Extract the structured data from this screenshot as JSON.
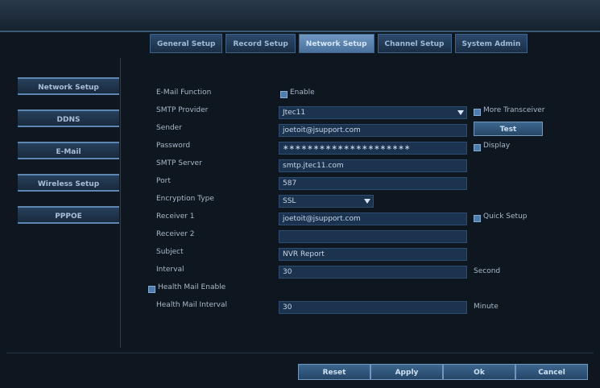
{
  "tabs": [
    {
      "label": "General Setup"
    },
    {
      "label": "Record Setup"
    },
    {
      "label": "Network Setup",
      "active": true
    },
    {
      "label": "Channel Setup"
    },
    {
      "label": "System Admin"
    }
  ],
  "sidebar": {
    "items": [
      {
        "label": "Network Setup"
      },
      {
        "label": "DDNS"
      },
      {
        "label": "E-Mail"
      },
      {
        "label": "Wireless Setup"
      },
      {
        "label": "PPPOE"
      }
    ]
  },
  "form": {
    "email_function_label": "E-Mail Function",
    "enable_label": "Enable",
    "smtp_provider_label": "SMTP Provider",
    "smtp_provider_value": "Jtec11",
    "more_transceiver_label": "More Transceiver",
    "sender_label": "Sender",
    "sender_value": "joetoit@jsupport.com",
    "test_button": "Test",
    "password_label": "Password",
    "password_value": "∗∗∗∗∗∗∗∗∗∗∗∗∗∗∗∗∗∗∗∗∗",
    "display_label": "Display",
    "smtp_server_label": "SMTP Server",
    "smtp_server_value": "smtp.jtec11.com",
    "port_label": "Port",
    "port_value": "587",
    "encryption_label": "Encryption Type",
    "encryption_value": "SSL",
    "receiver1_label": "Receiver 1",
    "receiver1_value": "joetoit@jsupport.com",
    "quick_setup_label": "Quick Setup",
    "receiver2_label": "Receiver 2",
    "receiver2_value": "",
    "subject_label": "Subject",
    "subject_value": "NVR Report",
    "interval_label": "Interval",
    "interval_value": "30",
    "interval_unit": "Second",
    "health_mail_enable_label": "Health Mail Enable",
    "health_mail_interval_label": "Health Mail Interval",
    "health_mail_interval_value": "30",
    "health_mail_interval_unit": "Minute"
  },
  "footer": {
    "reset": "Reset",
    "apply": "Apply",
    "ok": "Ok",
    "cancel": "Cancel"
  },
  "colors": {
    "accent": "#4f7cae",
    "field_bg": "#1c3350",
    "tab_active": "#6f97c2"
  }
}
